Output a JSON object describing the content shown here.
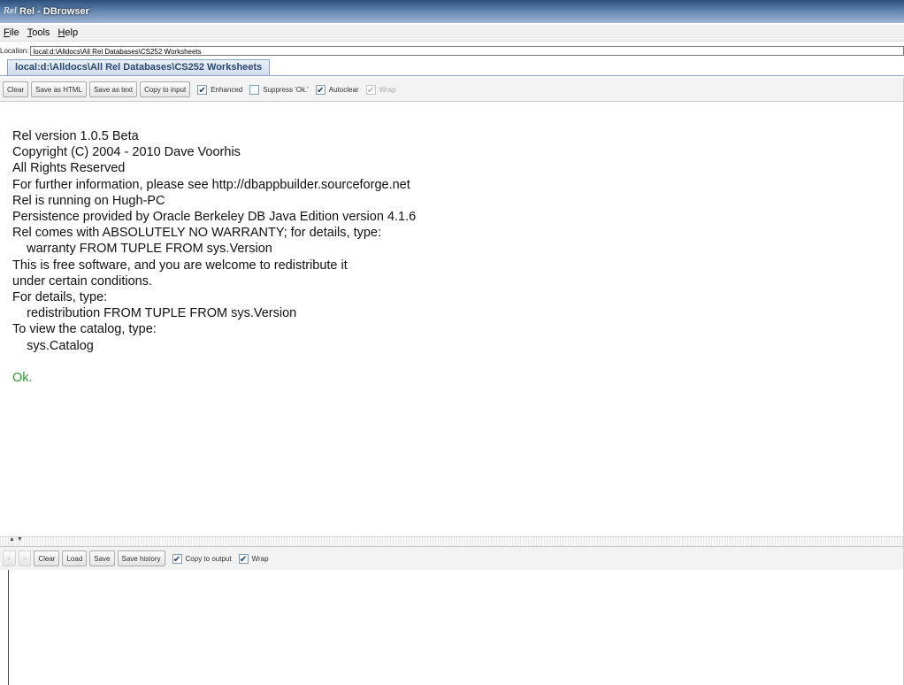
{
  "window": {
    "icon_text": "Rel",
    "title": "Rel - DBrowser"
  },
  "menu": [
    {
      "key": "F",
      "rest": "ile"
    },
    {
      "key": "T",
      "rest": "ools"
    },
    {
      "key": "H",
      "rest": "elp"
    }
  ],
  "location": {
    "label": "Location:",
    "value": "local:d:\\Alldocs\\All Rel Databases\\CS252 Worksheets"
  },
  "tab": {
    "label": "local:d:\\Alldocs\\All Rel Databases\\CS252 Worksheets"
  },
  "output_toolbar": {
    "clear": "Clear",
    "save_html": "Save as HTML",
    "save_text": "Save as text",
    "copy_input": "Copy to input",
    "enhanced": "Enhanced",
    "suppress_ok": "Suppress 'Ok.'",
    "autoclear": "Autoclear",
    "wrap": "Wrap"
  },
  "output": {
    "lines": [
      "Rel version 1.0.5 Beta",
      "Copyright (C) 2004 - 2010 Dave Voorhis",
      "All Rights Reserved",
      "For further information, please see http://dbappbuilder.sourceforge.net",
      "Rel is running on Hugh-PC",
      "Persistence provided by Oracle Berkeley DB Java Edition version 4.1.6",
      "Rel comes with ABSOLUTELY NO WARRANTY; for details, type:",
      "    warranty FROM TUPLE FROM sys.Version",
      "This is free software, and you are welcome to redistribute it",
      "under certain conditions.",
      "For details, type:",
      "    redistribution FROM TUPLE FROM sys.Version",
      "To view the catalog, type:",
      "    sys.Catalog"
    ],
    "ok": "Ok."
  },
  "input_toolbar": {
    "prev": "<",
    "next": ">",
    "clear": "Clear",
    "load": "Load",
    "save": "Save",
    "save_history": "Save history",
    "copy_output": "Copy to output",
    "wrap": "Wrap"
  },
  "checked_mark": "✔",
  "colors": {
    "ok": "#2b9a2b",
    "title_bar": "#2d4f7c"
  }
}
